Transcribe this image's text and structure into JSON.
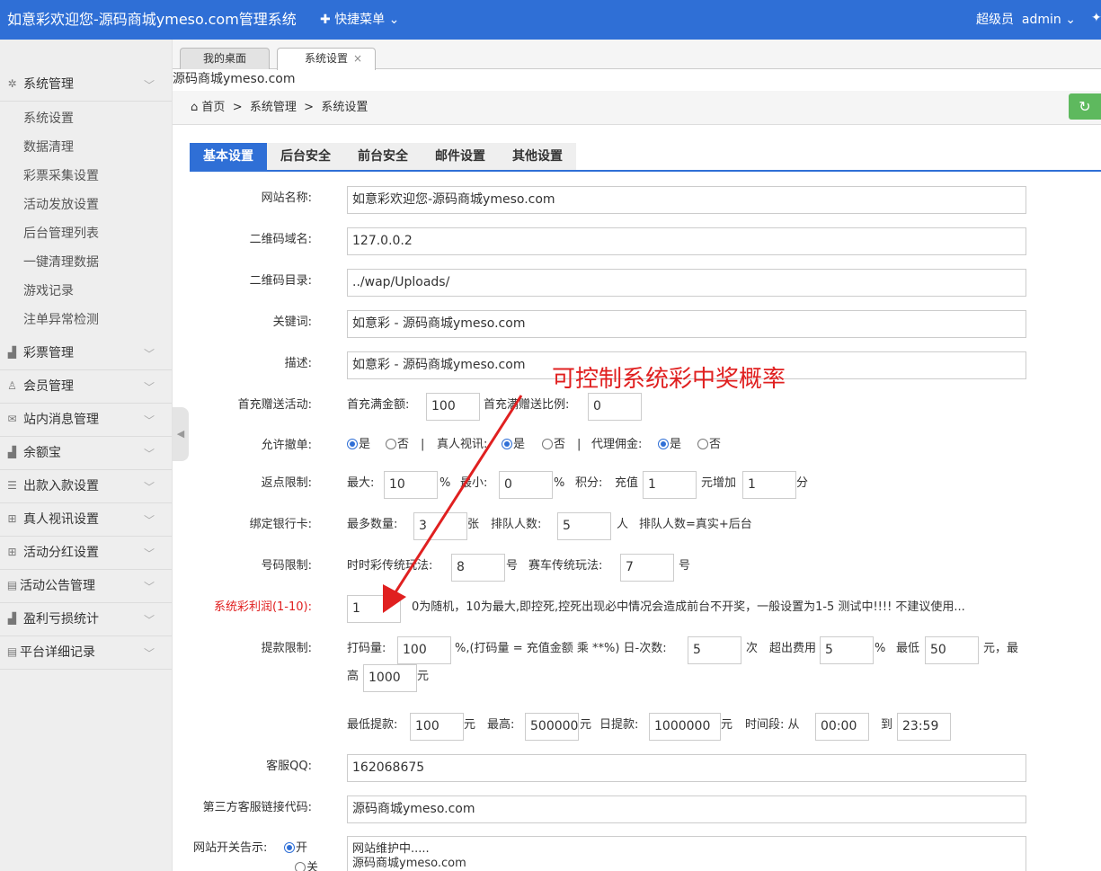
{
  "header": {
    "app_title": "如意彩欢迎您-源码商城ymeso.com管理系统",
    "quick_menu": "快捷菜单",
    "role": "超级员",
    "username": "admin"
  },
  "sidebar": {
    "groups": [
      {
        "label": "系统管理",
        "icon": "gear-icon"
      },
      {
        "label": "彩票管理",
        "icon": "bar-chart-icon"
      },
      {
        "label": "会员管理",
        "icon": "user-icon"
      },
      {
        "label": "站内消息管理",
        "icon": "envelope-icon"
      },
      {
        "label": "余额宝",
        "icon": "bar-chart-icon"
      },
      {
        "label": "出款入款设置",
        "icon": "list-icon"
      },
      {
        "label": "真人视讯设置",
        "icon": "grid-icon"
      },
      {
        "label": "活动分红设置",
        "icon": "grid-icon"
      },
      {
        "label": "活动公告管理",
        "icon": "newspaper-icon"
      },
      {
        "label": "盈利亏损统计",
        "icon": "bar-chart-icon"
      },
      {
        "label": "平台详细记录",
        "icon": "newspaper-icon"
      }
    ],
    "subitems": [
      "系统设置",
      "数据清理",
      "彩票采集设置",
      "活动发放设置",
      "后台管理列表",
      "一键清理数据",
      "游戏记录",
      "注单异常检测"
    ]
  },
  "page_tabs": [
    {
      "label": "我的桌面"
    },
    {
      "label": "系统设置",
      "close": "×"
    }
  ],
  "watermark": "源码商城ymeso.com",
  "breadcrumb": {
    "home": "首页",
    "sep": ">",
    "level1": "系统管理",
    "level2": "系统设置"
  },
  "settings_tabs": [
    "基本设置",
    "后台安全",
    "前台安全",
    "邮件设置",
    "其他设置"
  ],
  "form": {
    "site_name": {
      "label": "网站名称:",
      "value": "如意彩欢迎您-源码商城ymeso.com"
    },
    "qr_domain": {
      "label": "二维码域名:",
      "value": "127.0.0.2"
    },
    "qr_dir": {
      "label": "二维码目录:",
      "value": "../wap/Uploads/"
    },
    "keywords": {
      "label": "关键词:",
      "value": "如意彩 - 源码商城ymeso.com"
    },
    "description": {
      "label": "描述:",
      "value": "如意彩 - 源码商城ymeso.com"
    },
    "first_deposit": {
      "label": "首充赠送活动:",
      "full_label": "首充满金额:",
      "full_value": "100",
      "ratio_label": "首充满赠送比例:",
      "ratio_value": "0"
    },
    "allow": {
      "label": "允许撤单:",
      "yes": "是",
      "no": "否",
      "sep": "|",
      "live_label": "真人视讯:",
      "agent_label": "代理佣金:"
    },
    "rebate": {
      "label": "返点限制:",
      "max_label": "最大:",
      "max_value": "10",
      "pct": "%",
      "min_label": "最小:",
      "min_value": "0",
      "points_label": "积分:",
      "recharge_label": "充值",
      "recharge_value": "1",
      "add_label": "元增加",
      "add_value": "1",
      "unit": "分"
    },
    "bank": {
      "label": "绑定银行卡:",
      "max_label": "最多数量:",
      "max_value": "3",
      "max_unit": "张",
      "queue_label": "排队人数:",
      "queue_value": "5",
      "queue_unit": "人",
      "note": "排队人数=真实+后台"
    },
    "number_limit": {
      "label": "号码限制:",
      "ssc_label": "时时彩传统玩法:",
      "ssc_value": "8",
      "unit": "号",
      "race_label": "赛车传统玩法:",
      "race_value": "7"
    },
    "profit": {
      "label": "系统彩利润(1-10):",
      "value": "1",
      "note": "0为随机，10为最大,即控死,控死出现必中情况会造成前台不开奖，一般设置为1-5 测试中!!!! 不建议使用..."
    },
    "withdraw": {
      "label": "提款限制:",
      "bet_label": "打码量:",
      "bet_value": "100",
      "formula": "%,(打码量 = 充值金额 乘 **%) 日-次数:",
      "times_value": "5",
      "times_unit": "次",
      "overfee_label": "超出费用",
      "overfee_value": "5",
      "pct": "%",
      "min_fee_label": "最低",
      "min_fee_value": "50",
      "yuan_max": "元，最",
      "max_cont": "高",
      "max_fee_value": "1000",
      "yuan": "元",
      "min_w_label": "最低提款:",
      "min_w_value": "100",
      "max_w_label": "最高:",
      "max_w_value": "500000",
      "daily_label": "日提款:",
      "daily_value": "1000000",
      "period_label": "时间段: 从",
      "from_value": "00:00",
      "to_label": "到",
      "to_value": "23:59"
    },
    "qq": {
      "label": "客服QQ:",
      "value": "162068675"
    },
    "third_party": {
      "label": "第三方客服链接代码:",
      "value": "源码商城ymeso.com"
    },
    "site_switch": {
      "label": "网站开关告示:",
      "on": "开",
      "off": "关",
      "text_line1": "网站维护中.....",
      "text_line2": "源码商城ymeso.com"
    }
  },
  "annotation": "可控制系统彩中奖概率",
  "colors": {
    "brand": "#2f6fd6",
    "annotation": "#e02020",
    "refresh": "#5eb95e"
  }
}
